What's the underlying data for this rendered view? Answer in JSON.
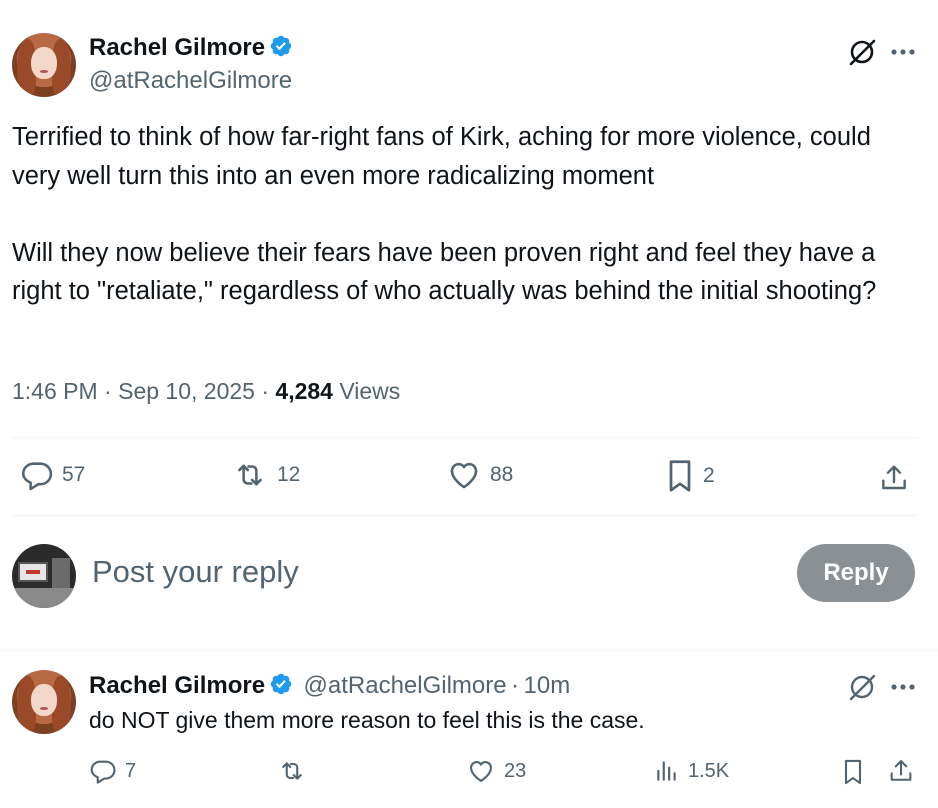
{
  "post": {
    "author_name": "Rachel Gilmore",
    "author_handle": "@atRachelGilmore",
    "text": "Terrified to think of how far-right fans of Kirk, aching for more violence, could very well turn this into an even more radicalizing moment\n\nWill they now believe their fears have been proven right and feel they have a right to \"retaliate,\" regardless of who actually was behind the initial shooting?",
    "time": "1:46 PM",
    "sep1": "·",
    "date": "Sep 10, 2025",
    "sep2": "·",
    "views_count": "4,284",
    "views_label": "Views",
    "replies": "57",
    "reposts": "12",
    "likes": "88",
    "bookmarks": "2"
  },
  "composer": {
    "placeholder": "Post your reply",
    "reply_label": "Reply"
  },
  "reply": {
    "author_name": "Rachel Gilmore",
    "author_handle": "@atRachelGilmore",
    "sep": "·",
    "age": "10m",
    "text": "do NOT give them more reason to feel this is the case.",
    "replies": "7",
    "reposts": "",
    "likes": "23",
    "views": "1.5K"
  },
  "icons": {
    "verified": "verified-badge-icon",
    "grok": "grok-icon",
    "more": "more-icon",
    "reply": "reply-icon",
    "repost": "repost-icon",
    "like": "heart-icon",
    "bookmark": "bookmark-icon",
    "share": "share-icon",
    "views": "analytics-icon"
  },
  "colors": {
    "verified": "#1d9bf0",
    "text": "#0f1419",
    "muted": "#536471",
    "reply_button": "#8b9094",
    "divider": "#eff3f4"
  }
}
